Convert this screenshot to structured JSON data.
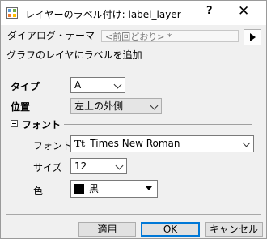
{
  "window": {
    "title": "レイヤーのラベル付け: label_layer",
    "help": "?",
    "close": "✕"
  },
  "theme": {
    "label": "ダイアログ・テーマ",
    "value": "<前回どおり> *"
  },
  "description": "グラフのレイヤにラベルを追加",
  "fields": {
    "type_label": "タイプ",
    "type_value": "A",
    "position_label": "位置",
    "position_value": "左上の外側"
  },
  "font_section": {
    "title": "フォント",
    "font_label": "フォント",
    "font_icon": "Tt",
    "font_value": "Times New Roman",
    "size_label": "サイズ",
    "size_value": "12",
    "color_label": "色",
    "color_value": "黒",
    "color_swatch": "#000000"
  },
  "buttons": {
    "apply": "適用",
    "ok": "OK",
    "cancel": "キャンセル"
  }
}
